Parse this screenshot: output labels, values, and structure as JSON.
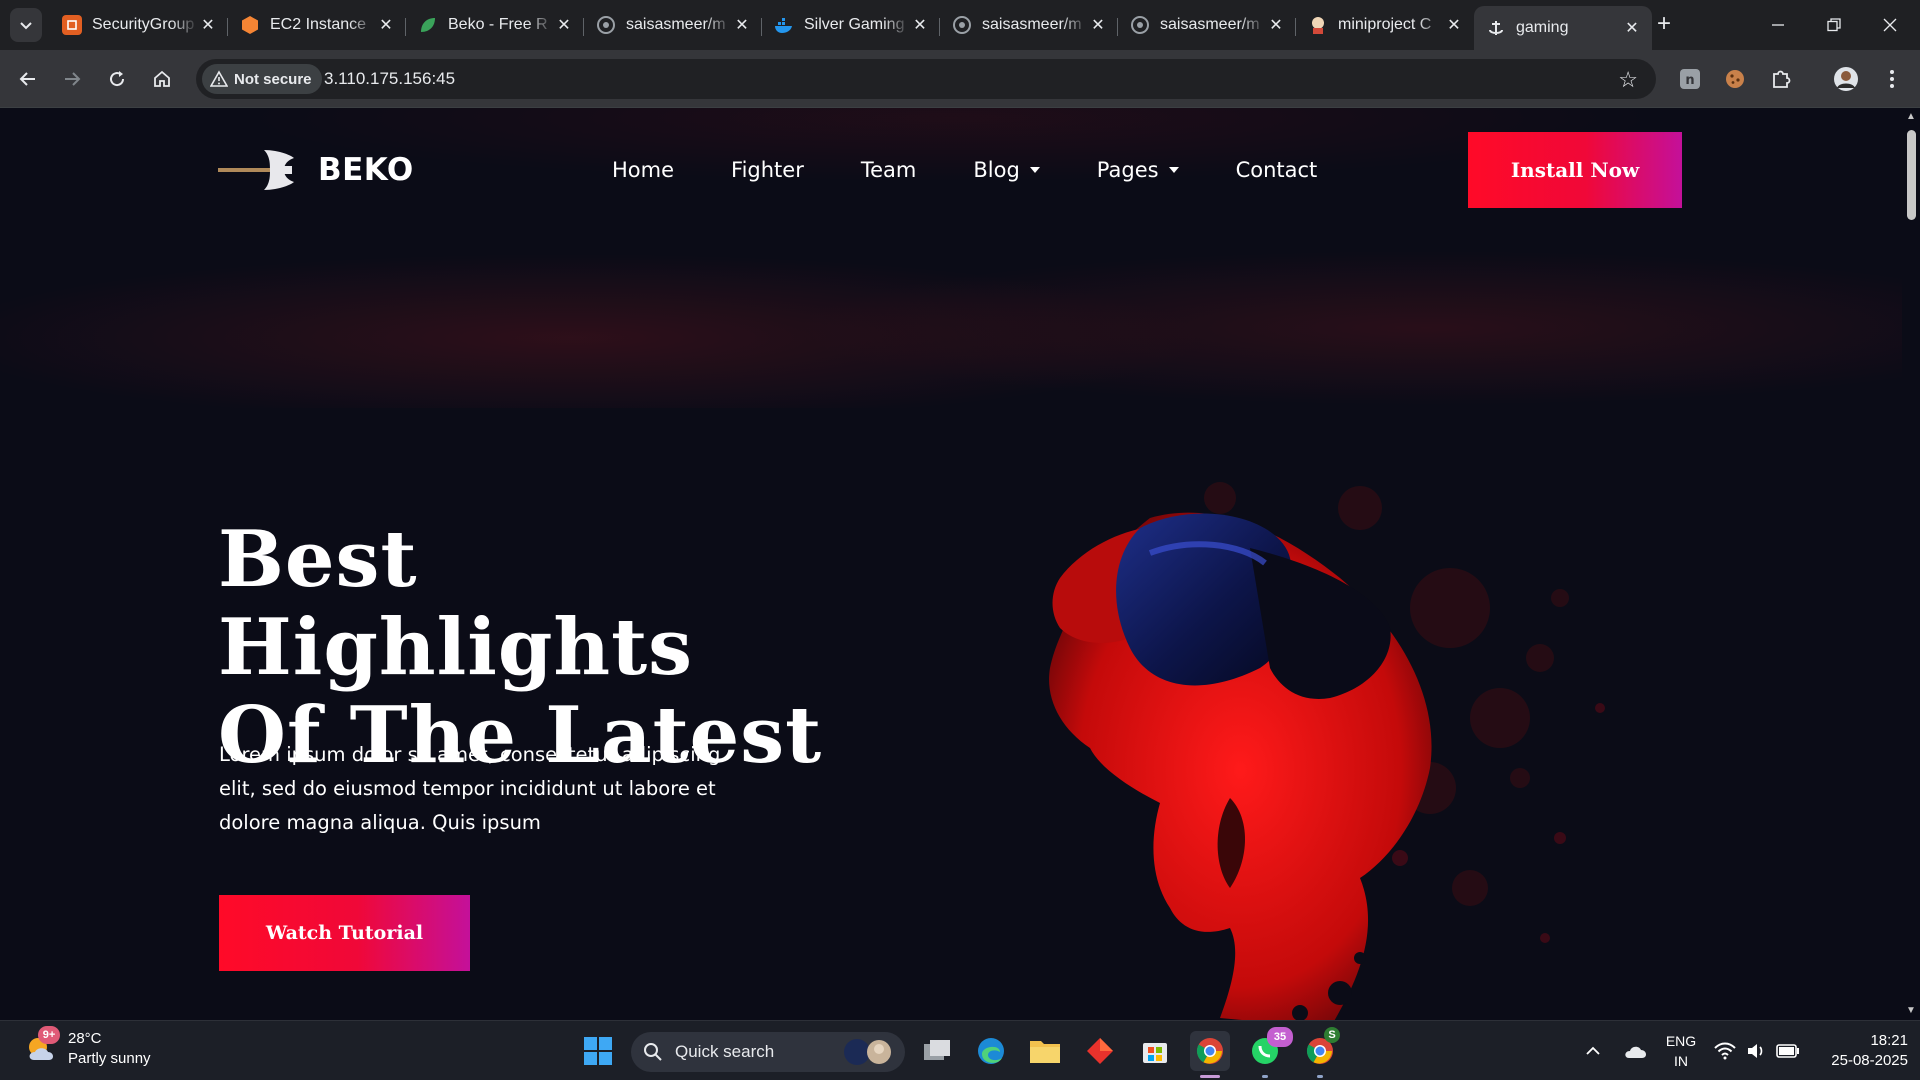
{
  "browser": {
    "tabs": [
      {
        "title": "SecurityGroup",
        "favicon": "aws-security-group-icon",
        "color": "#e25f22"
      },
      {
        "title": "EC2 Instance",
        "favicon": "aws-ec2-icon",
        "color": "#f58534"
      },
      {
        "title": "Beko - Free R",
        "favicon": "beko-leaf-icon",
        "color": "#3aa35a"
      },
      {
        "title": "saisasmeer/m",
        "favicon": "github-icon",
        "color": "#9aa0a6"
      },
      {
        "title": "Silver Gaming",
        "favicon": "docker-icon",
        "color": "#2496ed"
      },
      {
        "title": "saisasmeer/m",
        "favicon": "github-icon",
        "color": "#9aa0a6"
      },
      {
        "title": "saisasmeer/m",
        "favicon": "github-icon",
        "color": "#9aa0a6"
      },
      {
        "title": "miniproject C",
        "favicon": "jenkins-icon",
        "color": "#d24939"
      },
      {
        "title": "gaming",
        "favicon": "anchor-icon",
        "color": "#e8eaed",
        "active": true
      }
    ],
    "address": {
      "security_label": "Not secure",
      "url": "3.110.175.156:45"
    }
  },
  "site": {
    "brand": "BEKO",
    "nav": [
      {
        "label": "Home",
        "dropdown": false
      },
      {
        "label": "Fighter",
        "dropdown": false
      },
      {
        "label": "Team",
        "dropdown": false
      },
      {
        "label": "Blog",
        "dropdown": true
      },
      {
        "label": "Pages",
        "dropdown": true
      },
      {
        "label": "Contact",
        "dropdown": false
      }
    ],
    "install_label": "Install Now",
    "hero": {
      "title_line1": "Best Highlights",
      "title_line2": "Of The Latest",
      "text": "Lorem ipsum dolor sit amet, consectetur adipiscing elit, sed do eiusmod tempor incididunt ut labore et dolore magna aliqua. Quis ipsum",
      "button_label": "Watch Tutorial"
    },
    "colors": {
      "background": "#0b0c17",
      "accent_start": "#ff0a28",
      "accent_end": "#c4109a"
    }
  },
  "taskbar": {
    "weather": {
      "temp": "28°C",
      "desc": "Partly sunny",
      "badge": "9+"
    },
    "search_placeholder": "Quick search",
    "whatsapp_badge": "35",
    "chrome_profile_badge": "S",
    "language": {
      "line1": "ENG",
      "line2": "IN"
    },
    "time": "18:21",
    "date": "25-08-2025"
  }
}
